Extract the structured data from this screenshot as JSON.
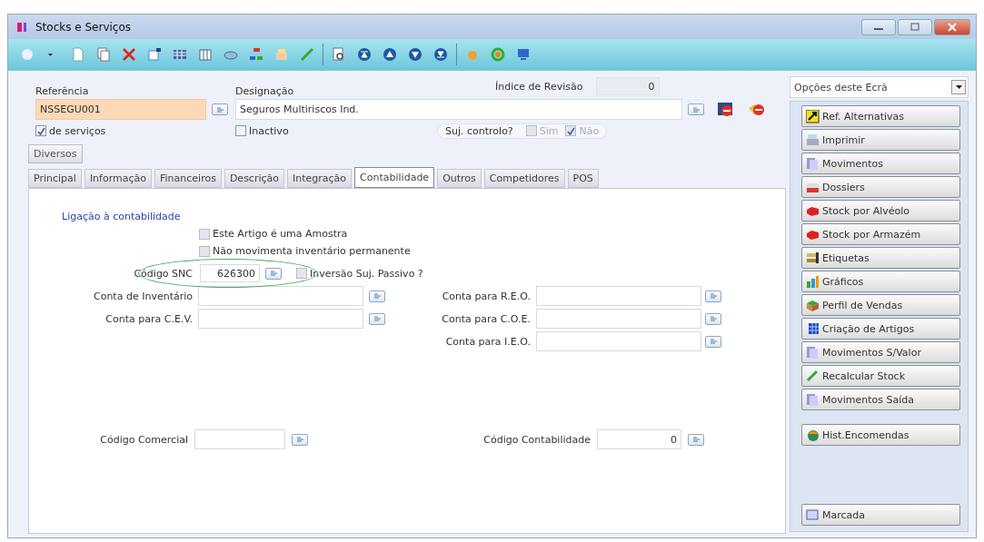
{
  "window": {
    "title": "Stocks e Serviços"
  },
  "header": {
    "referencia": {
      "label": "Referência",
      "value": "NSSEGU001"
    },
    "designacao": {
      "label": "Designação",
      "value": "Seguros Multiriscos Ind."
    },
    "indice_revisao": {
      "label": "Índice de Revisão",
      "value": "0"
    },
    "de_servicos": {
      "label": "de serviços",
      "checked": true
    },
    "inactivo": {
      "label": "Inactivo",
      "checked": false
    },
    "suj_controlo": {
      "label": "Suj. controlo?",
      "options": [
        {
          "label": "Sim",
          "checked": false
        },
        {
          "label": "Não",
          "checked": true
        }
      ]
    }
  },
  "group_tabs": [
    {
      "label": "Diversos",
      "selected": true
    }
  ],
  "tabs": [
    {
      "label": "Principal",
      "selected": false
    },
    {
      "label": "Informação",
      "selected": false
    },
    {
      "label": "Financeiros",
      "selected": false
    },
    {
      "label": "Descrição",
      "selected": false
    },
    {
      "label": "Integração",
      "selected": false
    },
    {
      "label": "Contabilidade",
      "selected": true
    },
    {
      "label": "Outros",
      "selected": false
    },
    {
      "label": "Competidores",
      "selected": false
    },
    {
      "label": "POS",
      "selected": false
    }
  ],
  "panel": {
    "section_title": "Ligação à contabilidade",
    "checkboxes": [
      {
        "label": "Este Artigo é uma Amostra",
        "checked": false
      },
      {
        "label": "Não movimenta inventário permanente",
        "checked": false
      }
    ],
    "codigo_snc": {
      "label": "Código SNC",
      "value": "626300",
      "highlighted": true
    },
    "inversao": {
      "label": "Inversão Suj. Passivo ?",
      "checked": false
    },
    "accounts": [
      {
        "left": "Conta de Inventário",
        "right": "Conta para R.E.O."
      },
      {
        "left": "Conta para C.E.V.",
        "right": "Conta para C.O.E."
      },
      {
        "right": "Conta para I.E.O."
      }
    ],
    "codigo_comercial": {
      "label": "Código Comercial"
    },
    "codigo_contabilidade": {
      "label": "Código Contabilidade",
      "value": "0"
    }
  },
  "options": {
    "title": "Opções deste Ecrã",
    "buttons": [
      {
        "label": "Ref. Alternativas",
        "kind": "stacked"
      },
      {
        "label": "Imprimir",
        "kind": "stacked"
      },
      {
        "label": "Movimentos",
        "kind": "stacked"
      },
      {
        "label": "Dossiers",
        "kind": "stacked"
      },
      {
        "label": "Stock por Alvéolo",
        "kind": "stacked"
      },
      {
        "label": "Stock por Armazém",
        "kind": "stacked"
      },
      {
        "label": "Etiquetas",
        "kind": "stacked"
      },
      {
        "label": "Gráficos",
        "kind": "stacked"
      },
      {
        "label": "Perfil de Vendas",
        "kind": "stacked"
      },
      {
        "label": "Criação de Artigos",
        "kind": "stacked"
      },
      {
        "label": "Movimentos S/Valor",
        "kind": "stacked"
      },
      {
        "label": "Recalcular Stock",
        "kind": "stacked"
      },
      {
        "label": "Movimentos Saída",
        "kind": "stacked"
      },
      {
        "label": "Hist.Encomendas",
        "kind": "separated"
      },
      {
        "label": "Marcada",
        "kind": "bottom"
      }
    ]
  }
}
